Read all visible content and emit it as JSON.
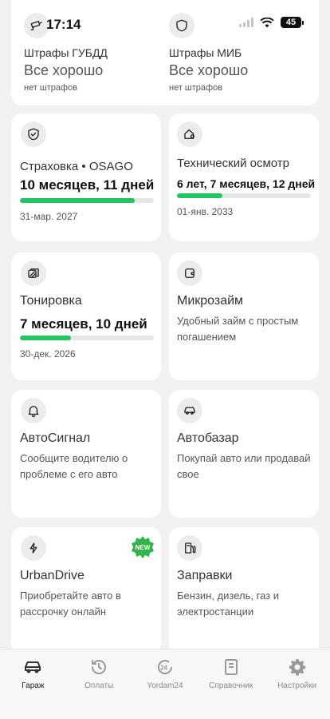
{
  "status": {
    "time": "17:14",
    "battery": "45"
  },
  "fines": {
    "gibdd": {
      "title": "Штрафы ГУБДД",
      "status": "Все хорошо",
      "note": "нет штрафов"
    },
    "mib": {
      "title": "Штрафы МИБ",
      "status": "Все хорошо",
      "note": "нет штрафов"
    }
  },
  "cards": {
    "insurance": {
      "title": "Страховка • OSAGO",
      "value": "10 месяцев, 11 дней",
      "date": "31-мар. 2027",
      "progress": 0.86
    },
    "inspection": {
      "title": "Технический осмотр",
      "value": "6 лет, 7 месяцев, 12 дней",
      "date": "01-янв. 2033",
      "progress": 0.34
    },
    "tinting": {
      "title": "Тонировка",
      "value": "7 месяцев, 10 дней",
      "date": "30-дек. 2026",
      "progress": 0.38
    },
    "microloan": {
      "title": "Микрозайм",
      "desc": "Удобный займ с простым погашением"
    },
    "autosignal": {
      "title": "АвтоСигнал",
      "desc": "Сообщите водителю о проблеме с его авто"
    },
    "autobazar": {
      "title": "Автобазар",
      "desc": "Покупай авто или продавай свое"
    },
    "urbandrive": {
      "title": "UrbanDrive",
      "desc": "Приобретайте авто в рассрочку онлайн",
      "badge": "NEW"
    },
    "fuel": {
      "title": "Заправки",
      "desc": "Бензин, дизель, газ и электростанции"
    }
  },
  "colors": {
    "accent": "#22c55e",
    "badge": "#2fb54a"
  },
  "tabs": [
    {
      "label": "Гараж",
      "icon": "car-icon",
      "active": true
    },
    {
      "label": "Оплаты",
      "icon": "history-icon",
      "active": false
    },
    {
      "label": "Yordam24",
      "icon": "support-24-icon",
      "active": false
    },
    {
      "label": "Справочник",
      "icon": "book-icon",
      "active": false
    },
    {
      "label": "Настройки",
      "icon": "gear-icon",
      "active": false
    }
  ]
}
